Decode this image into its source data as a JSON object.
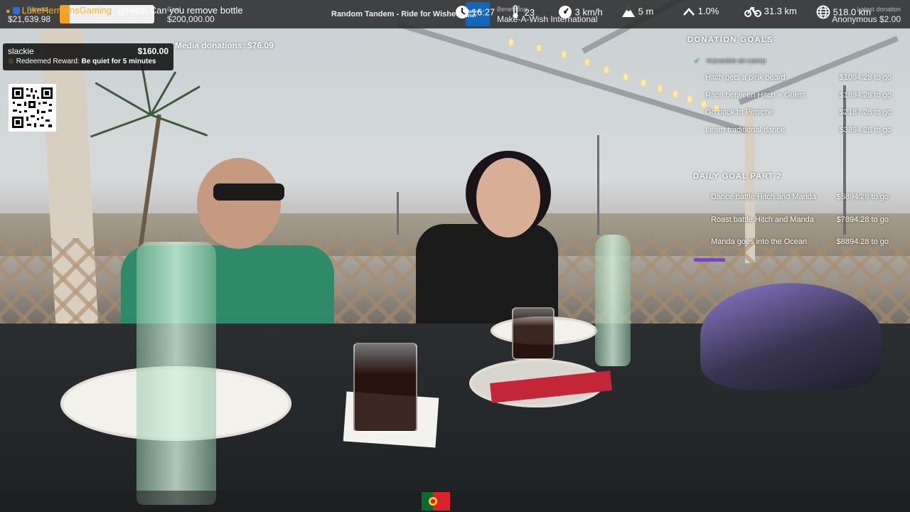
{
  "top_bar": {
    "raised_label": "Raised",
    "raised_value": "$21,639.98",
    "goal_label": "Goal",
    "goal_value": "$200,000.00",
    "progress_fraction": 0.108,
    "progress_color": "#f4a11f",
    "stream_title": "Random Tandem - Ride for Wishes",
    "benefitting_label": "Benefitting",
    "benefitting_value": "Make-A-Wish International",
    "logo_text": "Make-A-Wish",
    "latest_label": "Latest donation",
    "latest_value": "Anonymous $2.00"
  },
  "alert": {
    "username": "slackie",
    "amount": "$160.00",
    "reward_prefix": "Redeemed Reward:",
    "reward_name": "Be quiet for 5 minutes"
  },
  "media_donations": "Media donations: $76.09",
  "donation_goals": {
    "title": "DONATION GOALS",
    "completed": "Karaoke at camp",
    "items": [
      {
        "name": "Hitch gets a pink beard",
        "amount": "$1094.28 to go"
      },
      {
        "name": "Race between Hitch + Guest",
        "amount": "$1894.28 to go"
      },
      {
        "name": "Go back to Peniche",
        "amount": "$2187.28 to go"
      },
      {
        "name": "Learn traditional dance",
        "amount": "$3894.28 to go"
      }
    ]
  },
  "daily_goals": {
    "title": "DAILY GOAL PART 2",
    "items": [
      {
        "name": "Dance battle Hitch and Manda",
        "amount": "$5894.28 to go"
      },
      {
        "name": "Roast battle Hitch and Manda",
        "amount": "$7894.28 to go"
      },
      {
        "name": "Manda goes into the Ocean",
        "amount": "$8894.28 to go"
      }
    ],
    "accent_color": "#7b3fe4"
  },
  "chat": {
    "username": "LukeHermansGaming",
    "message": "@Hitch Can you remove bottle"
  },
  "stats": {
    "time": "16:27",
    "temperature": "23",
    "speed": "3 km/h",
    "altitude": "5 m",
    "incline": "1.0%",
    "day_distance": "31.3 km",
    "total_distance": "518.0 km"
  },
  "icons": {
    "clock": "clock-icon",
    "thermometer": "thermometer-icon",
    "speedometer": "speedometer-icon",
    "mountain": "mountain-icon",
    "incline": "chevron-up-icon",
    "bike": "bicycle-icon",
    "globe": "globe-icon",
    "flag": "portugal-flag-icon"
  }
}
